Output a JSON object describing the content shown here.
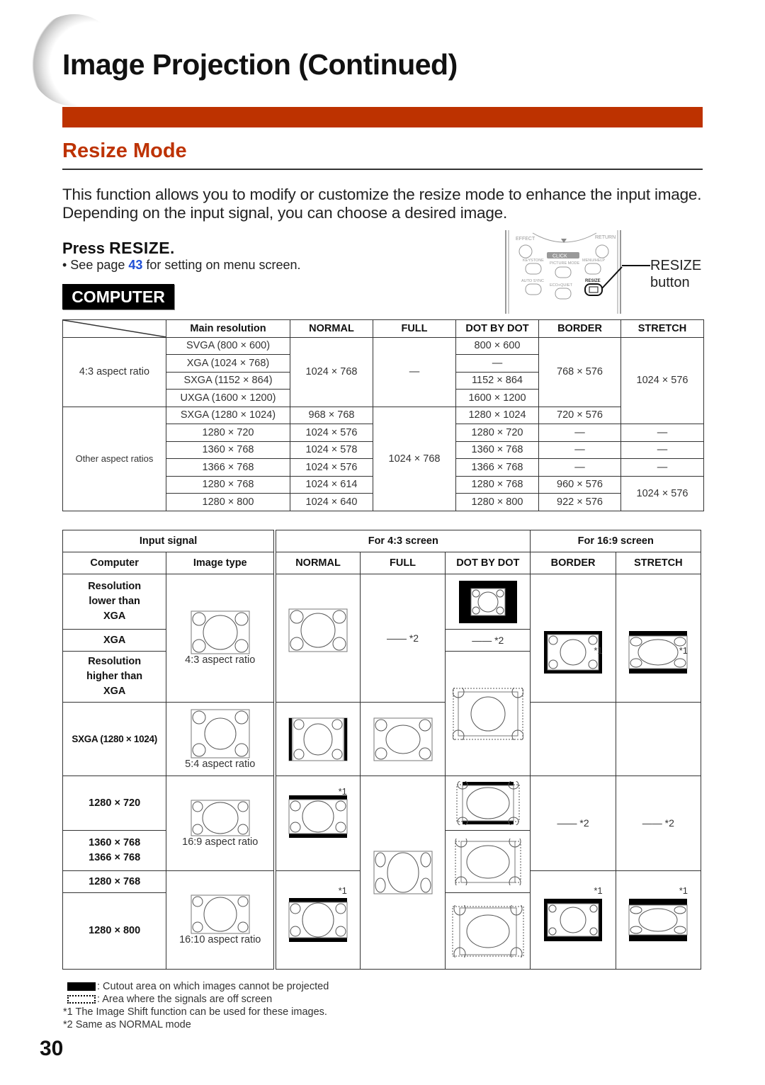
{
  "header": {
    "title": "Image Projection (Continued)",
    "accent_color": "#bd3200"
  },
  "section": {
    "title": "Resize Mode",
    "intro": "This function allows you to modify or customize the resize mode to enhance the input image. Depending on the input signal, you can choose a desired image."
  },
  "instruction": {
    "press_prefix": "Press ",
    "press_key": "RESIZE",
    "press_suffix": ".",
    "see_prefix": "• See page ",
    "see_page": "43",
    "see_suffix": " for setting on menu screen.",
    "link_color": "#1f4fd6"
  },
  "badge": "COMPUTER",
  "remote": {
    "labels": [
      "EFFECT",
      "RETURN",
      "CLICK",
      "KEYSTONE",
      "PICTURE MODE",
      "MENU/HELP",
      "AUTO SYNC",
      "ECO+QUIET",
      "RESIZE"
    ],
    "callout_line1": "RESIZE",
    "callout_line2": "button"
  },
  "table1": {
    "headers": [
      "Main resolution",
      "NORMAL",
      "FULL",
      "DOT BY DOT",
      "BORDER",
      "STRETCH"
    ],
    "group_43": "4:3 aspect ratio",
    "group_other": "Other aspect ratios",
    "rows": [
      {
        "res": "SVGA (800 × 600)",
        "normal": "1024 × 768",
        "full": "—",
        "dot": "800 × 600",
        "border": "768 × 576",
        "stretch": "1024 × 576"
      },
      {
        "res": "XGA (1024 × 768)",
        "dot": "—"
      },
      {
        "res": "SXGA (1152 × 864)",
        "dot": "1152 × 864"
      },
      {
        "res": "UXGA (1600 × 1200)",
        "dot": "1600 × 1200"
      },
      {
        "res": "SXGA (1280 × 1024)",
        "normal": "968 × 768",
        "full": "1024 × 768",
        "dot": "1280 × 1024",
        "border": "720 × 576"
      },
      {
        "res": "1280 × 720",
        "normal": "1024 × 576",
        "dot": "1280 × 720",
        "border": "—",
        "stretch": "—"
      },
      {
        "res": "1360 × 768",
        "normal": "1024 × 578",
        "dot": "1360 × 768",
        "border": "—",
        "stretch": "—"
      },
      {
        "res": "1366 × 768",
        "normal": "1024 × 576",
        "dot": "1366 × 768",
        "border": "—",
        "stretch": "—"
      },
      {
        "res": "1280 × 768",
        "normal": "1024 × 614",
        "dot": "1280 × 768",
        "border": "960 × 576",
        "stretch": "1024 × 576"
      },
      {
        "res": "1280 × 800",
        "normal": "1024 × 640",
        "dot": "1280 × 800",
        "border": "922 × 576"
      }
    ]
  },
  "table2": {
    "group_input": "Input signal",
    "group_43": "For 4:3 screen",
    "group_169": "For 16:9 screen",
    "headers": [
      "Computer",
      "Image type",
      "NORMAL",
      "FULL",
      "DOT BY DOT",
      "BORDER",
      "STRETCH"
    ],
    "computer": {
      "lower_xga": [
        "Resolution",
        "lower than",
        "XGA"
      ],
      "xga": "XGA",
      "higher_xga": [
        "Resolution",
        "higher than",
        "XGA"
      ],
      "sxga": "SXGA (1280 × 1024)",
      "r1280x720": "1280 × 720",
      "r1360x768": "1360 × 768",
      "r1366x768": "1366 × 768",
      "r1280x768": "1280 × 768",
      "r1280x800": "1280 × 800"
    },
    "image_types": {
      "a43": "4:3 aspect ratio",
      "a54": "5:4 aspect ratio",
      "a169": "16:9 aspect ratio",
      "a1610": "16:10 aspect ratio"
    },
    "same_as_normal": "*2",
    "image_shift": "*1"
  },
  "legend": {
    "cutout": ": Cutout area on which images cannot be projected",
    "offscreen": ": Area where the signals are off screen",
    "note1": "*1 The Image Shift function can be used for these images.",
    "note2": "*2 Same as NORMAL mode"
  },
  "page_number": "30"
}
